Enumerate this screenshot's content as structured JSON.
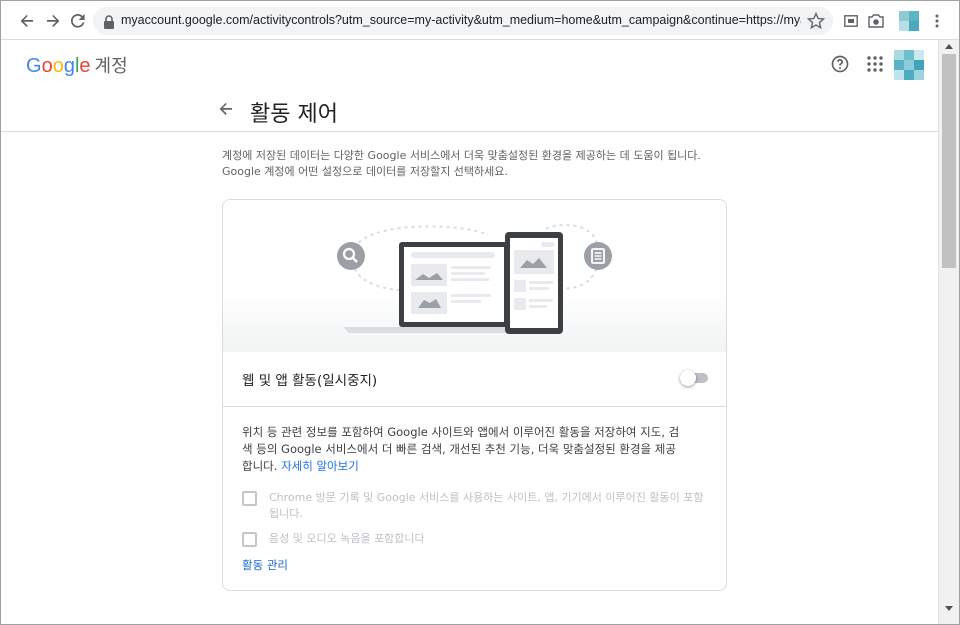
{
  "browser": {
    "url": "myaccount.google.com/activitycontrols?utm_source=my-activity&utm_medium=home&utm_campaign&continue=https://myactivity.googl..."
  },
  "header": {
    "logo_letters": [
      "G",
      "o",
      "o",
      "g",
      "l",
      "e"
    ],
    "account_label": "계정"
  },
  "page": {
    "title": "활동 제어",
    "description_line1": "계정에 저장된 데이터는 다양한 Google 서비스에서 더욱 맞춤설정된 환경을 제공하는 데 도움이 됩니다.",
    "description_line2": "Google 계정에 어떤 설정으로 데이터를 저장할지 선택하세요."
  },
  "card": {
    "setting_label": "웹 및 앱 활동(일시중지)",
    "toggle_on": false,
    "body_text": "위치 등 관련 정보를 포함하여 Google 사이트와 앱에서 이루어진 활동을 저장하여 지도, 검색 등의 Google 서비스에서 더 빠른 검색, 개선된 추천 기능, 더욱 맞춤설정된 환경을 제공합니다.",
    "learn_more": "자세히 알아보기",
    "checkbox1_label": "Chrome 방문 기록 및 Google 서비스를 사용하는 사이트, 앱, 기기에서 이루어진 활동이 포함됩니다.",
    "checkbox2_label": "음성 및 오디오 녹음을 포함합니다",
    "manage_link": "활동 관리"
  },
  "colors": {
    "link": "#1a73e8",
    "disabled_text": "#bdc1c6",
    "toggle_off_track": "#bdc1c6"
  },
  "icons": [
    "back-arrow-icon",
    "forward-arrow-icon",
    "reload-icon",
    "lock-icon",
    "star-icon",
    "cast-icon",
    "camera-icon",
    "menu-icon",
    "help-icon",
    "apps-grid-icon",
    "avatar",
    "search-icon",
    "document-icon"
  ]
}
